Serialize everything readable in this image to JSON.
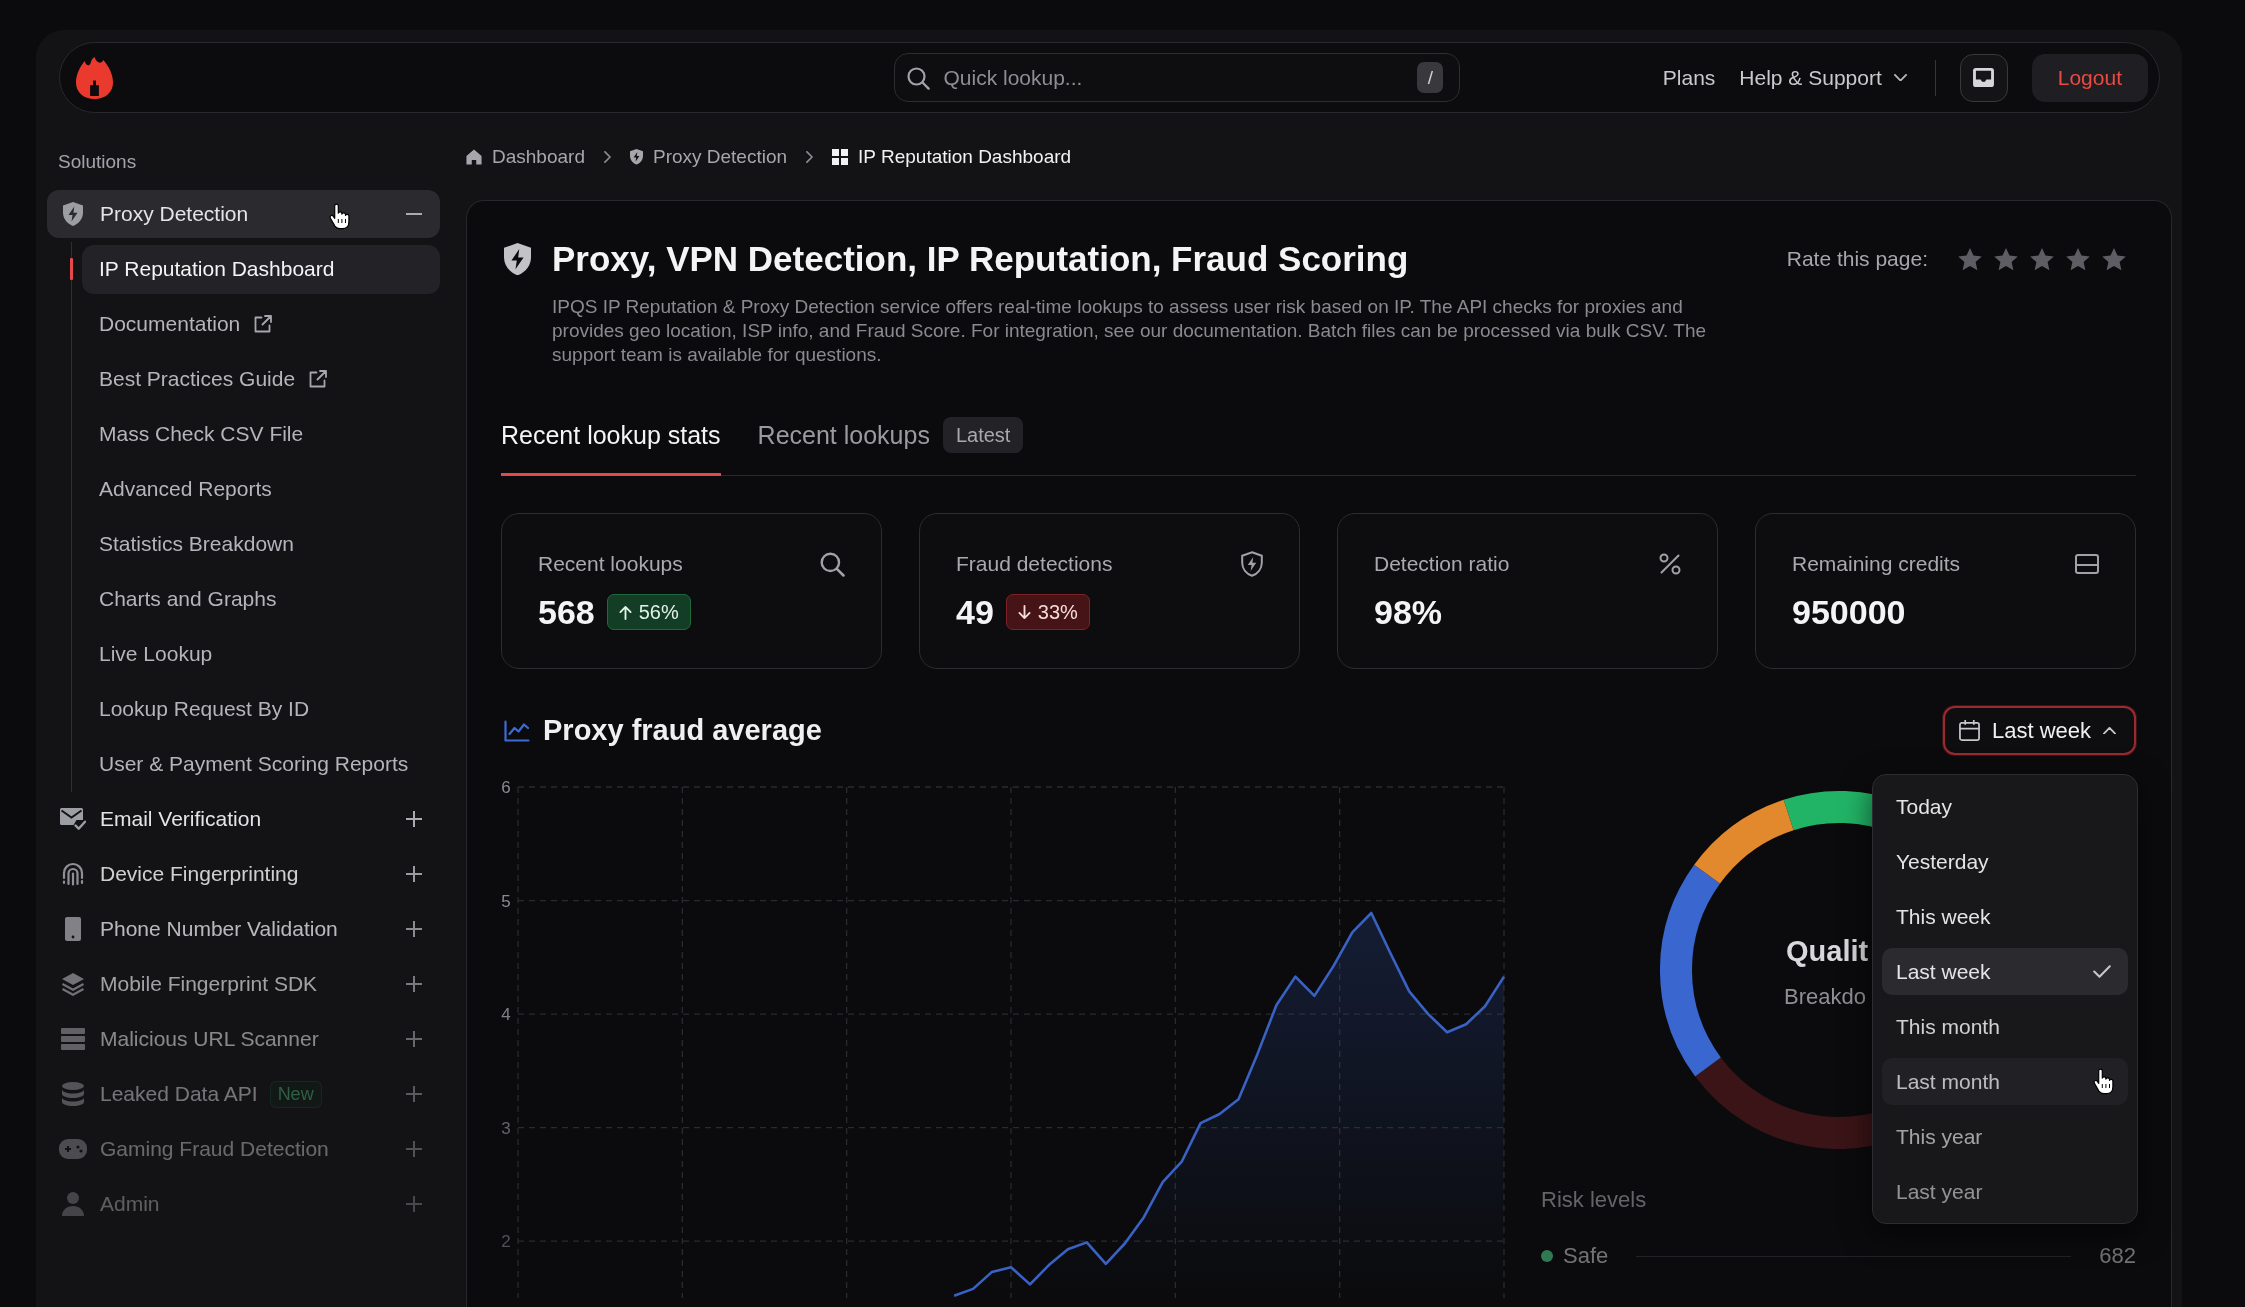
{
  "top_bar": {
    "search": {
      "placeholder": "Quick lookup...",
      "shortcut": "/"
    },
    "nav_links": [
      {
        "label": "Plans",
        "has_menu": false
      },
      {
        "label": "Help & Support",
        "has_menu": true
      }
    ],
    "logout": "Logout"
  },
  "sidebar": {
    "heading": "Solutions",
    "groups": [
      {
        "label": "Proxy Detection",
        "expanded": true,
        "hovered": true,
        "children": [
          {
            "label": "IP Reputation Dashboard",
            "selected": true,
            "external": false
          },
          {
            "label": "Documentation",
            "selected": false,
            "external": true
          },
          {
            "label": "Best Practices Guide",
            "selected": false,
            "external": true
          },
          {
            "label": "Mass Check CSV File",
            "selected": false,
            "external": false
          },
          {
            "label": "Advanced Reports",
            "selected": false,
            "external": false
          },
          {
            "label": "Statistics Breakdown",
            "selected": false,
            "external": false
          },
          {
            "label": "Charts and Graphs",
            "selected": false,
            "external": false
          },
          {
            "label": "Live Lookup",
            "selected": false,
            "external": false
          },
          {
            "label": "Lookup Request By ID",
            "selected": false,
            "external": false
          },
          {
            "label": "User & Payment Scoring Reports",
            "selected": false,
            "external": false
          }
        ]
      },
      {
        "label": "Email Verification",
        "expanded": false,
        "hovered": false
      },
      {
        "label": "Device Fingerprinting",
        "expanded": false,
        "hovered": false
      },
      {
        "label": "Phone Number Validation",
        "expanded": false,
        "hovered": false
      },
      {
        "label": "Mobile Fingerprint SDK",
        "expanded": false,
        "hovered": false
      },
      {
        "label": "Malicious URL Scanner",
        "expanded": false,
        "hovered": false
      },
      {
        "label": "Leaked Data API",
        "expanded": false,
        "hovered": false,
        "badge": "New"
      },
      {
        "label": "Gaming Fraud Detection",
        "expanded": false,
        "hovered": false
      },
      {
        "label": "Admin",
        "expanded": false,
        "hovered": false
      }
    ]
  },
  "breadcrumb": [
    {
      "label": "Dashboard",
      "current": false
    },
    {
      "label": "Proxy Detection",
      "current": false
    },
    {
      "label": "IP Reputation Dashboard",
      "current": true
    }
  ],
  "page_header": {
    "title": "Proxy, VPN Detection, IP Reputation, Fraud Scoring",
    "description": "IPQS IP Reputation & Proxy Detection service offers real-time lookups to assess user risk based on IP. The API checks for proxies and provides geo location, ISP info, and Fraud Score. For integration, see our documentation. Batch files can be processed via bulk CSV. The support team is available for questions.",
    "rating": {
      "label": "Rate this page:",
      "stars": 0
    }
  },
  "tabs": [
    {
      "label": "Recent lookup stats",
      "selected": true
    },
    {
      "label": "Recent lookups",
      "selected": false,
      "badge": "Latest"
    }
  ],
  "stat_cards": [
    {
      "label": "Recent lookups",
      "value": "568",
      "change": {
        "text": "56%",
        "increase": true
      }
    },
    {
      "label": "Fraud detections",
      "value": "49",
      "change": {
        "text": "33%",
        "increase": false
      }
    },
    {
      "label": "Detection ratio",
      "value": "98%"
    },
    {
      "label": "Remaining credits",
      "value": "950000"
    }
  ],
  "chart_section": {
    "title": "Proxy fraud average",
    "period_button": {
      "label": "Last week",
      "open": true
    },
    "chart_data": {
      "type": "area",
      "grid": true,
      "ylim": [
        1.5,
        6
      ],
      "yticks": [
        2,
        3,
        4,
        5,
        6
      ],
      "categories": [
        null,
        null,
        null,
        null,
        null,
        null,
        null,
        null,
        null,
        null,
        null,
        null,
        null,
        null,
        null,
        null,
        null,
        null,
        null,
        null,
        null,
        null,
        null,
        null,
        null,
        null,
        null,
        null,
        null,
        null,
        null,
        null,
        null,
        null,
        null,
        null,
        null,
        null,
        null,
        null,
        null,
        null,
        null,
        null,
        null,
        null,
        null,
        null,
        null,
        null,
        null,
        null,
        null
      ],
      "values": [
        null,
        null,
        null,
        null,
        null,
        null,
        null,
        null,
        null,
        null,
        null,
        null,
        null,
        null,
        null,
        null,
        null,
        null,
        null,
        null,
        null,
        null,
        null,
        1.52,
        1.58,
        1.73,
        1.77,
        1.62,
        1.79,
        1.93,
        1.99,
        1.8,
        1.98,
        2.21,
        2.52,
        2.7,
        3.04,
        3.12,
        3.25,
        3.65,
        4.08,
        4.33,
        4.16,
        4.42,
        4.72,
        4.89,
        4.54,
        4.2,
        4.0,
        3.84,
        3.91,
        4.07,
        4.33
      ]
    },
    "period_menu": [
      {
        "label": "Today",
        "selected": false,
        "hovered": false
      },
      {
        "label": "Yesterday",
        "selected": false,
        "hovered": false
      },
      {
        "label": "This week",
        "selected": false,
        "hovered": false
      },
      {
        "label": "Last week",
        "selected": true,
        "hovered": false
      },
      {
        "label": "This month",
        "selected": false,
        "hovered": false
      },
      {
        "label": "Last month",
        "selected": false,
        "hovered": true
      },
      {
        "label": "This year",
        "selected": false,
        "hovered": false
      },
      {
        "label": "Last year",
        "selected": false,
        "hovered": false
      }
    ]
  },
  "donut_panel": {
    "center_title": "Qualit",
    "center_subtitle": "Breakdo",
    "legend_title": "Risk levels",
    "legend": [
      {
        "label": "Safe",
        "value": "682"
      }
    ]
  }
}
